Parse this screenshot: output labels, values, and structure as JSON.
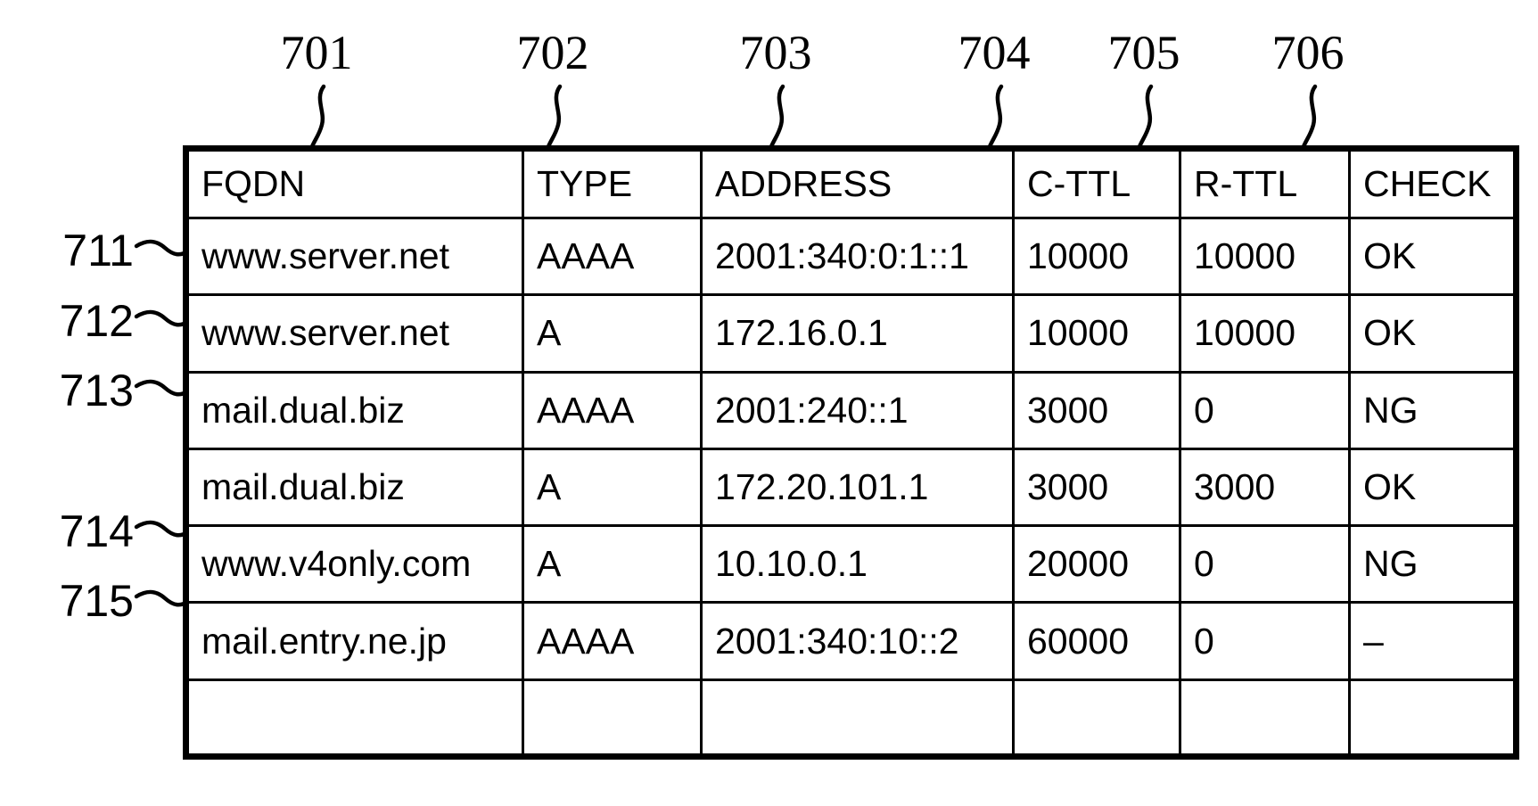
{
  "figure": {
    "title": "DNS address record table",
    "ink_color": "#000000",
    "background_color": "#ffffff"
  },
  "column_callouts": [
    {
      "label": "701",
      "target_column": "FQDN"
    },
    {
      "label": "702",
      "target_column": "TYPE"
    },
    {
      "label": "703",
      "target_column": "ADDRESS"
    },
    {
      "label": "704",
      "target_column": "C-TTL"
    },
    {
      "label": "705",
      "target_column": "R-TTL"
    },
    {
      "label": "706",
      "target_column": "CHECK"
    }
  ],
  "row_callouts": [
    {
      "label": "711",
      "target_row_index": 0
    },
    {
      "label": "712",
      "target_row_index": 1
    },
    {
      "label": "713",
      "target_row_index": 2
    },
    {
      "label": "714",
      "target_row_index": 4
    },
    {
      "label": "715",
      "target_row_index": 5
    }
  ],
  "table": {
    "headers": [
      "FQDN",
      "TYPE",
      "ADDRESS",
      "C-TTL",
      "R-TTL",
      "CHECK"
    ],
    "rows": [
      {
        "fqdn": "www.server.net",
        "type": "AAAA",
        "address": "2001:340:0:1::1",
        "c_ttl": "10000",
        "r_ttl": "10000",
        "check": "OK"
      },
      {
        "fqdn": "www.server.net",
        "type": "A",
        "address": "172.16.0.1",
        "c_ttl": "10000",
        "r_ttl": "10000",
        "check": "OK"
      },
      {
        "fqdn": "mail.dual.biz",
        "type": "AAAA",
        "address": "2001:240::1",
        "c_ttl": "3000",
        "r_ttl": "0",
        "check": "NG"
      },
      {
        "fqdn": "mail.dual.biz",
        "type": "A",
        "address": "172.20.101.1",
        "c_ttl": "3000",
        "r_ttl": "3000",
        "check": "OK"
      },
      {
        "fqdn": "www.v4only.com",
        "type": "A",
        "address": "10.10.0.1",
        "c_ttl": "20000",
        "r_ttl": "0",
        "check": "NG"
      },
      {
        "fqdn": "mail.entry.ne.jp",
        "type": "AAAA",
        "address": "2001:340:10::2",
        "c_ttl": "60000",
        "r_ttl": "0",
        "check": "–"
      },
      {
        "fqdn": "",
        "type": "",
        "address": "",
        "c_ttl": "",
        "r_ttl": "",
        "check": ""
      }
    ]
  }
}
